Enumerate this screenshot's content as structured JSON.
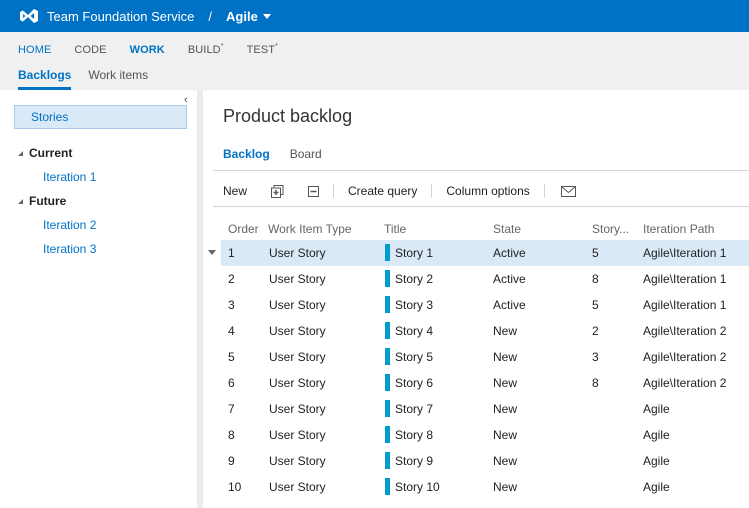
{
  "topbar": {
    "logo_icon": "visual-studio-logo-icon",
    "service": "Team Foundation Service",
    "separator": "/",
    "project": "Agile"
  },
  "hubs": [
    {
      "label": "HOME",
      "suffix": "",
      "active": false
    },
    {
      "label": "CODE",
      "suffix": "",
      "active": false
    },
    {
      "label": "WORK",
      "suffix": "",
      "active": true
    },
    {
      "label": "BUILD",
      "suffix": "*",
      "active": false
    },
    {
      "label": "TEST",
      "suffix": "*",
      "active": false
    }
  ],
  "subtabs": [
    {
      "label": "Backlogs",
      "active": true
    },
    {
      "label": "Work items",
      "active": false
    }
  ],
  "leftpane": {
    "collapse_glyph": "‹",
    "selected": "Stories",
    "groups": [
      {
        "label": "Current",
        "items": [
          "Iteration 1"
        ]
      },
      {
        "label": "Future",
        "items": [
          "Iteration 2",
          "Iteration 3"
        ]
      }
    ]
  },
  "main": {
    "title": "Product backlog",
    "pivots": [
      {
        "label": "Backlog",
        "active": true
      },
      {
        "label": "Board",
        "active": false
      }
    ],
    "toolbar": {
      "new_label": "New",
      "expand_icon": "expand-all-icon",
      "collapse_icon": "collapse-all-icon",
      "create_query_label": "Create query",
      "column_options_label": "Column options",
      "email_icon": "email-icon"
    },
    "grid": {
      "columns": [
        "Order",
        "Work Item Type",
        "Title",
        "State",
        "Story...",
        "Iteration Path"
      ],
      "rows": [
        {
          "order": "1",
          "type": "User Story",
          "title": "Story 1",
          "state": "Active",
          "points": "5",
          "iteration": "Agile\\Iteration 1",
          "selected": true
        },
        {
          "order": "2",
          "type": "User Story",
          "title": "Story 2",
          "state": "Active",
          "points": "8",
          "iteration": "Agile\\Iteration 1",
          "selected": false
        },
        {
          "order": "3",
          "type": "User Story",
          "title": "Story 3",
          "state": "Active",
          "points": "5",
          "iteration": "Agile\\Iteration 1",
          "selected": false
        },
        {
          "order": "4",
          "type": "User Story",
          "title": "Story 4",
          "state": "New",
          "points": "2",
          "iteration": "Agile\\Iteration 2",
          "selected": false
        },
        {
          "order": "5",
          "type": "User Story",
          "title": "Story 5",
          "state": "New",
          "points": "3",
          "iteration": "Agile\\Iteration 2",
          "selected": false
        },
        {
          "order": "6",
          "type": "User Story",
          "title": "Story 6",
          "state": "New",
          "points": "8",
          "iteration": "Agile\\Iteration 2",
          "selected": false
        },
        {
          "order": "7",
          "type": "User Story",
          "title": "Story 7",
          "state": "New",
          "points": "",
          "iteration": "Agile",
          "selected": false
        },
        {
          "order": "8",
          "type": "User Story",
          "title": "Story 8",
          "state": "New",
          "points": "",
          "iteration": "Agile",
          "selected": false
        },
        {
          "order": "9",
          "type": "User Story",
          "title": "Story 9",
          "state": "New",
          "points": "",
          "iteration": "Agile",
          "selected": false
        },
        {
          "order": "10",
          "type": "User Story",
          "title": "Story 10",
          "state": "New",
          "points": "",
          "iteration": "Agile",
          "selected": false
        }
      ]
    }
  },
  "colors": {
    "brand": "#0072c6",
    "selection": "#dae9f7",
    "story_bar": "#009ccc"
  }
}
